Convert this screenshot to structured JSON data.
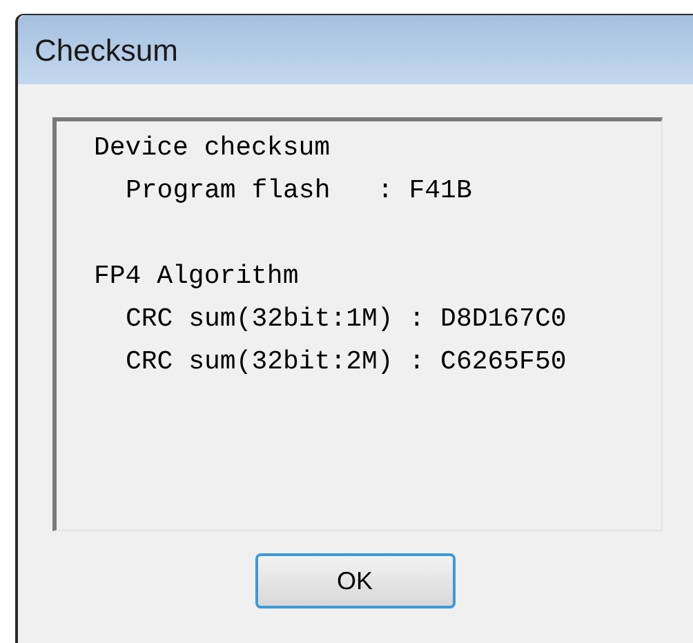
{
  "window": {
    "title": "Checksum"
  },
  "sections": [
    {
      "heading": "Device checksum",
      "lines": [
        "Program flash   : F41B"
      ]
    },
    {
      "heading": "FP4 Algorithm",
      "lines": [
        "CRC sum(32bit:1M) : D8D167C0",
        "CRC sum(32bit:2M) : C6265F50"
      ]
    }
  ],
  "buttons": [
    {
      "label": "OK",
      "default": true
    }
  ]
}
